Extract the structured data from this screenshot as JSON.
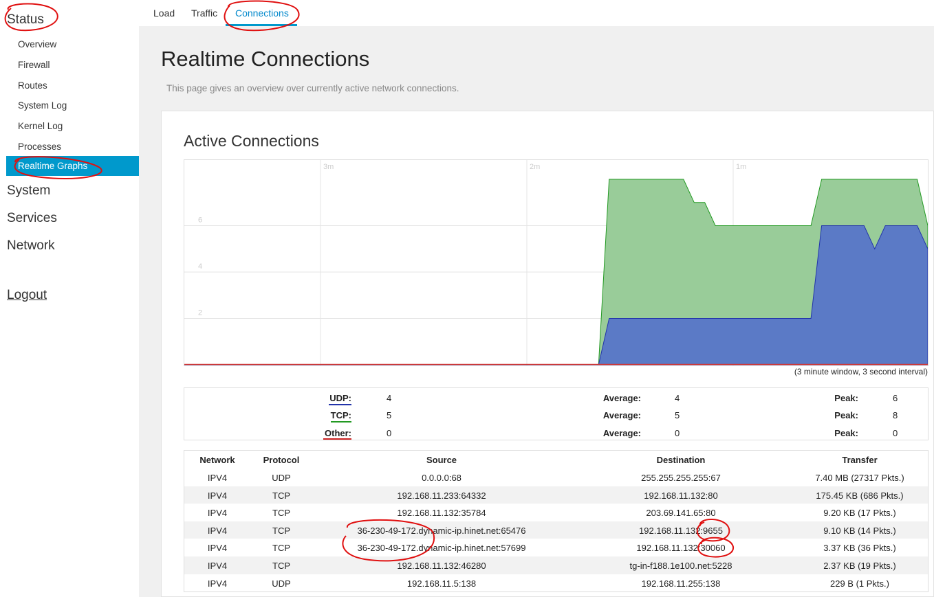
{
  "sidebar": {
    "status": "Status",
    "items": [
      "Overview",
      "Firewall",
      "Routes",
      "System Log",
      "Kernel Log",
      "Processes"
    ],
    "active_item": "Realtime Graphs",
    "system": "System",
    "services": "Services",
    "network": "Network",
    "logout": "Logout"
  },
  "tabs": [
    "Load",
    "Traffic",
    "Connections"
  ],
  "page": {
    "title": "Realtime Connections",
    "description": "This page gives an overview over currently active network connections."
  },
  "section": {
    "title": "Active Connections",
    "caption": "(3 minute window, 3 second interval)"
  },
  "chart_data": {
    "type": "area",
    "x_labels": [
      "3m",
      "2m",
      "1m"
    ],
    "y_ticks": [
      "6",
      "4",
      "2"
    ],
    "ylim": [
      0,
      8
    ],
    "grid": true,
    "series": [
      {
        "name": "TCP",
        "color": "#99cc99",
        "values": [
          0,
          0,
          0,
          0,
          0,
          0,
          0,
          0,
          0,
          0,
          0,
          0,
          0,
          0,
          0,
          0,
          0,
          0,
          0,
          0,
          0,
          0,
          0,
          0,
          0,
          0,
          0,
          0,
          0,
          0,
          0,
          0,
          0,
          0,
          0,
          0,
          0,
          0,
          0,
          0,
          8,
          8,
          8,
          8,
          8,
          8,
          8,
          8,
          7,
          7,
          6,
          6,
          6,
          6,
          6,
          6,
          6,
          6,
          6,
          6,
          8,
          8,
          8,
          8,
          8,
          8,
          8,
          8,
          8,
          8,
          6
        ]
      },
      {
        "name": "UDP",
        "color": "#5b7ac6",
        "values": [
          0,
          0,
          0,
          0,
          0,
          0,
          0,
          0,
          0,
          0,
          0,
          0,
          0,
          0,
          0,
          0,
          0,
          0,
          0,
          0,
          0,
          0,
          0,
          0,
          0,
          0,
          0,
          0,
          0,
          0,
          0,
          0,
          0,
          0,
          0,
          0,
          0,
          0,
          0,
          0,
          2,
          2,
          2,
          2,
          2,
          2,
          2,
          2,
          2,
          2,
          2,
          2,
          2,
          2,
          2,
          2,
          2,
          2,
          2,
          2,
          6,
          6,
          6,
          6,
          6,
          5,
          6,
          6,
          6,
          6,
          5
        ]
      },
      {
        "name": "Other",
        "color": "#cc3333",
        "values": [
          0,
          0,
          0,
          0,
          0,
          0,
          0,
          0,
          0,
          0,
          0,
          0,
          0,
          0,
          0,
          0,
          0,
          0,
          0,
          0,
          0,
          0,
          0,
          0,
          0,
          0,
          0,
          0,
          0,
          0,
          0,
          0,
          0,
          0,
          0,
          0,
          0,
          0,
          0,
          0,
          0,
          0,
          0,
          0,
          0,
          0,
          0,
          0,
          0,
          0,
          0,
          0,
          0,
          0,
          0,
          0,
          0,
          0,
          0,
          0,
          0,
          0,
          0,
          0,
          0,
          0,
          0,
          0,
          0,
          0,
          0
        ]
      }
    ]
  },
  "legend": {
    "average_label": "Average:",
    "peak_label": "Peak:",
    "rows": [
      {
        "label": "UDP:",
        "current": "4",
        "average": "4",
        "peak": "6",
        "color": "#2233aa"
      },
      {
        "label": "TCP:",
        "current": "5",
        "average": "5",
        "peak": "8",
        "color": "#229922"
      },
      {
        "label": "Other:",
        "current": "0",
        "average": "0",
        "peak": "0",
        "color": "#cc2222"
      }
    ]
  },
  "table": {
    "headers": [
      "Network",
      "Protocol",
      "Source",
      "Destination",
      "Transfer"
    ],
    "rows": [
      [
        "IPV4",
        "UDP",
        "0.0.0.0:68",
        "255.255.255.255:67",
        "7.40 MB (27317 Pkts.)"
      ],
      [
        "IPV4",
        "TCP",
        "192.168.11.233:64332",
        "192.168.11.132:80",
        "175.45 KB (686 Pkts.)"
      ],
      [
        "IPV4",
        "TCP",
        "192.168.11.132:35784",
        "203.69.141.65:80",
        "9.20 KB (17 Pkts.)"
      ],
      [
        "IPV4",
        "TCP",
        "36-230-49-172.dynamic-ip.hinet.net:65476",
        "192.168.11.132:9655",
        "9.10 KB (14 Pkts.)"
      ],
      [
        "IPV4",
        "TCP",
        "36-230-49-172.dynamic-ip.hinet.net:57699",
        "192.168.11.132:30060",
        "3.37 KB (36 Pkts.)"
      ],
      [
        "IPV4",
        "TCP",
        "192.168.11.132:46280",
        "tg-in-f188.1e100.net:5228",
        "2.37 KB (19 Pkts.)"
      ],
      [
        "IPV4",
        "UDP",
        "192.168.11.5:138",
        "192.168.11.255:138",
        "229 B (1 Pkts.)"
      ]
    ]
  }
}
